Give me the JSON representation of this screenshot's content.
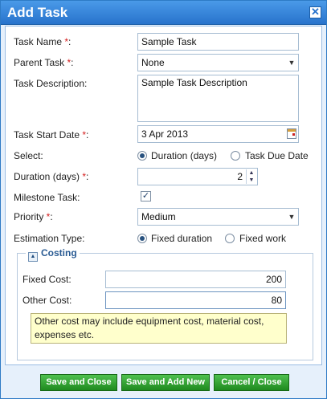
{
  "dialog": {
    "title": "Add Task",
    "close_glyph": "✕"
  },
  "form": {
    "task_name": {
      "label": "Task Name ",
      "req": "*",
      "colon": ":",
      "value": "Sample Task"
    },
    "parent_task": {
      "label": "Parent Task ",
      "req": "*",
      "colon": ":",
      "value": "None"
    },
    "task_description": {
      "label": "Task Description:",
      "value": "Sample Task Description"
    },
    "task_start_date": {
      "label": "Task Start Date ",
      "req": "*",
      "colon": ":",
      "value": "3 Apr 2013"
    },
    "select": {
      "label": "Select:",
      "options": [
        "Duration (days)",
        "Task Due Date"
      ],
      "selected": "Duration (days)"
    },
    "duration": {
      "label": "Duration (days) ",
      "req": "*",
      "colon": ":",
      "value": "2"
    },
    "milestone": {
      "label": "Milestone Task:",
      "checked": true,
      "glyph": "✓"
    },
    "priority": {
      "label": "Priority ",
      "req": "*",
      "colon": ":",
      "value": "Medium"
    },
    "estimation_type": {
      "label": "Estimation Type:",
      "options": [
        "Fixed duration",
        "Fixed work"
      ],
      "selected": "Fixed duration"
    }
  },
  "costing": {
    "legend": "Costing",
    "collapse_glyph": "▲",
    "fixed_cost": {
      "label": "Fixed Cost:",
      "value": "200"
    },
    "other_cost": {
      "label": "Other Cost:",
      "value": "80"
    },
    "note": "Other cost may include equipment cost, material cost, expenses etc."
  },
  "buttons": {
    "save_close": "Save and Close",
    "save_add_new": "Save and Add New",
    "cancel_close": "Cancel / Close"
  },
  "icons": {
    "dropdown": "▼",
    "spin_up": "▲",
    "spin_down": "▼"
  },
  "colors": {
    "title_bar": "#2873cc",
    "button_green": "#1f8a1f",
    "required": "#d41c1c",
    "note_bg": "#ffffcc"
  }
}
